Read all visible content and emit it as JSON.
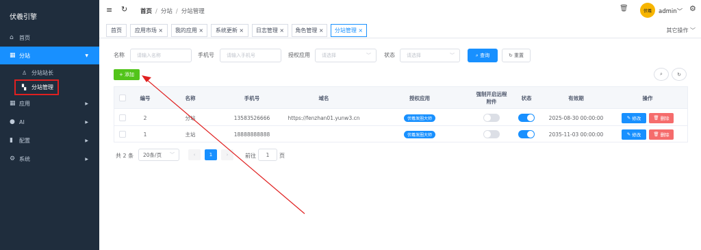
{
  "app": {
    "title": "伏羲引擎"
  },
  "sidebar": {
    "items": [
      {
        "label": "首页",
        "icon": "home-icon"
      },
      {
        "label": "分站",
        "icon": "building-icon"
      },
      {
        "label": "分站站长",
        "icon": "user-icon"
      },
      {
        "label": "分站管理",
        "icon": "grid-icon"
      },
      {
        "label": "应用",
        "icon": "apps-icon"
      },
      {
        "label": "AI",
        "icon": "location-pin-icon"
      },
      {
        "label": "配置",
        "icon": "bar-chart-icon"
      },
      {
        "label": "系统",
        "icon": "settings-icon"
      }
    ]
  },
  "header": {
    "breadcrumb": [
      "首页",
      "分站",
      "分站管理"
    ],
    "username": "admin",
    "avatar_text": "伏羲"
  },
  "tabs": {
    "items": [
      "首页",
      "应用市场",
      "我的应用",
      "系统更新",
      "日志管理",
      "角色管理",
      "分站管理"
    ],
    "other_ops": "其它操作"
  },
  "filters": {
    "name_label": "名称",
    "name_placeholder": "请输入名称",
    "phone_label": "手机号",
    "phone_placeholder": "请输入手机号",
    "app_label": "授权应用",
    "app_placeholder": "请选择",
    "status_label": "状态",
    "status_placeholder": "请选择",
    "search_btn": "查询",
    "reset_btn": "重置"
  },
  "toolbar": {
    "add_btn": "添加"
  },
  "table": {
    "headers": [
      "编号",
      "名称",
      "手机号",
      "域名",
      "授权应用",
      "强制开启远程附件",
      "状态",
      "有效期",
      "操作"
    ],
    "rows": [
      {
        "id": "2",
        "name": "分站",
        "phone": "13583526666",
        "domain": "https://fenzhan01.yunw3.cn",
        "app": "伏羲发圈大师",
        "force_remote": false,
        "status": true,
        "expire": "2025-08-30 00:00:00"
      },
      {
        "id": "1",
        "name": "主站",
        "phone": "18888888888",
        "domain": "",
        "app": "伏羲发圈大师",
        "force_remote": false,
        "status": true,
        "expire": "2035-11-03 00:00:00"
      }
    ],
    "edit_btn": "修改",
    "delete_btn": "删除"
  },
  "pagination": {
    "total_text": "共 2 条",
    "page_size": "20条/页",
    "current_page": "1",
    "goto_label": "前往",
    "goto_value": "1",
    "page_suffix": "页"
  },
  "colors": {
    "primary": "#1890ff",
    "success": "#52c41a",
    "danger": "#f56c6c",
    "sidebar_bg": "#1f2d3d",
    "annotation": "#e02020"
  }
}
